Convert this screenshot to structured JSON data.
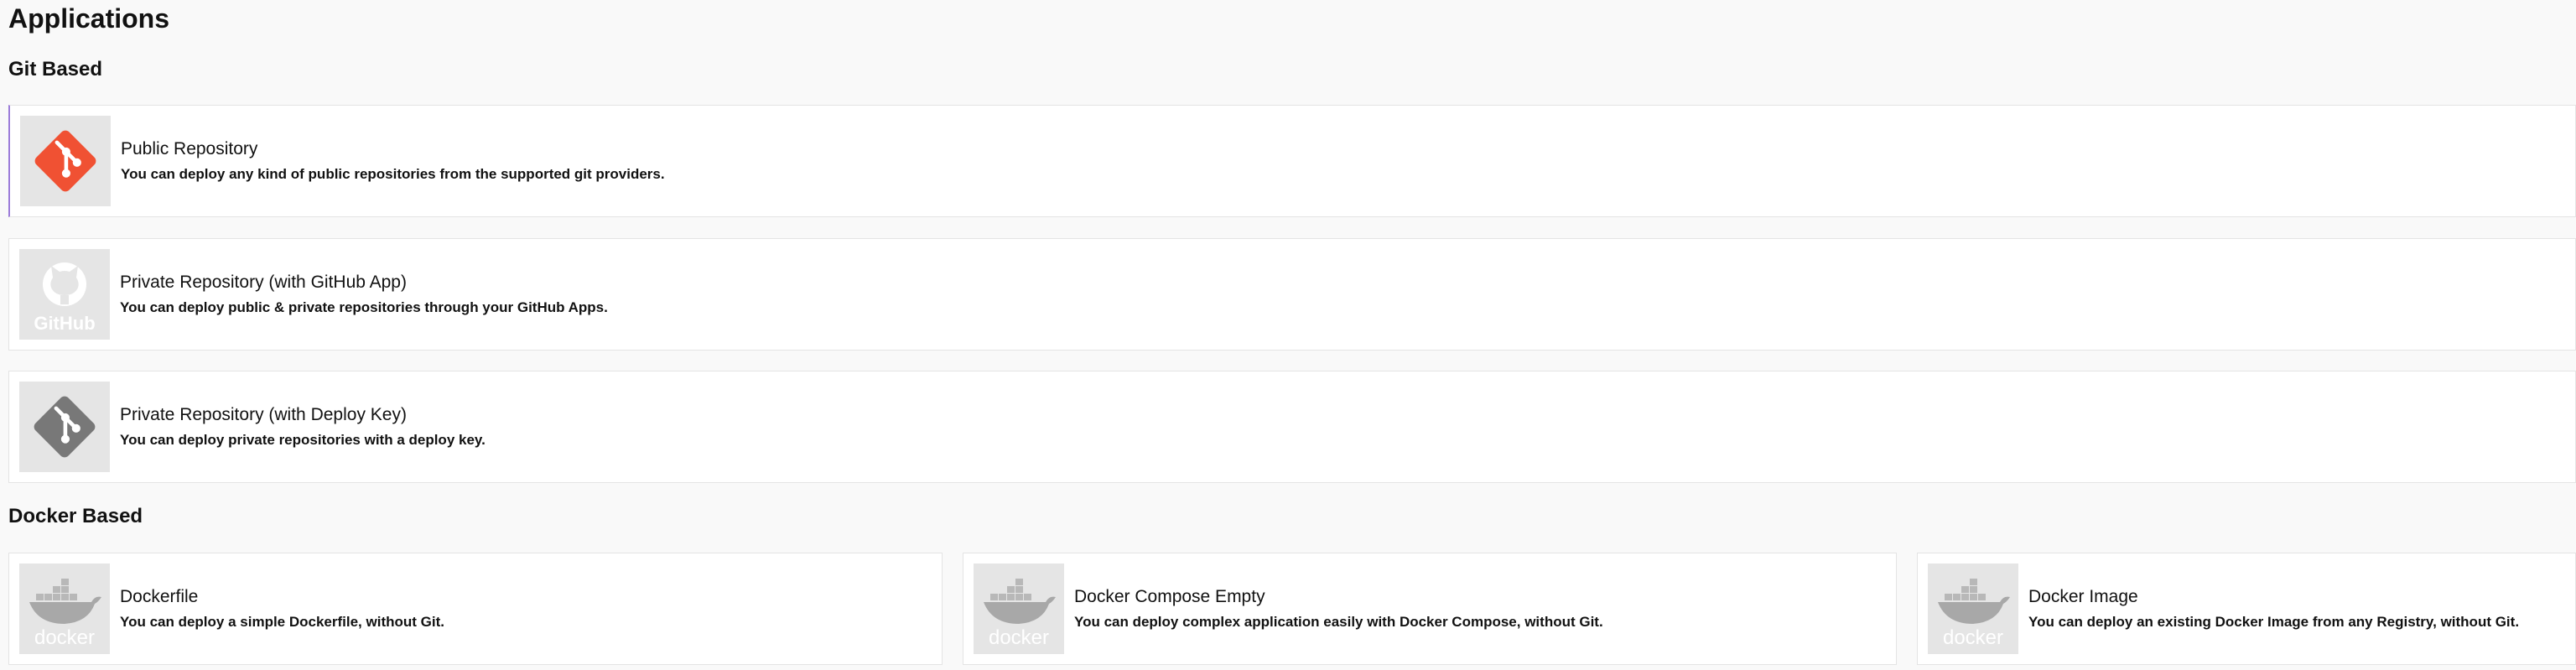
{
  "page": {
    "title": "Applications"
  },
  "git": {
    "heading": "Git Based",
    "items": [
      {
        "title": "Public Repository",
        "description": "You can deploy any kind of public repositories from the supported git providers.",
        "icon": "git-icon"
      },
      {
        "title": "Private Repository (with GitHub App)",
        "description": "You can deploy public & private repositories through your GitHub Apps.",
        "icon": "github-icon",
        "logo_text": "GitHub"
      },
      {
        "title": "Private Repository (with Deploy Key)",
        "description": "You can deploy private repositories with a deploy key.",
        "icon": "git-icon"
      }
    ]
  },
  "docker": {
    "heading": "Docker Based",
    "items": [
      {
        "title": "Dockerfile",
        "description": "You can deploy a simple Dockerfile, without Git.",
        "icon": "docker-icon",
        "logo_text": "docker"
      },
      {
        "title": "Docker Compose Empty",
        "description": "You can deploy complex application easily with Docker Compose, without Git.",
        "icon": "docker-icon",
        "logo_text": "docker"
      },
      {
        "title": "Docker Image",
        "description": "You can deploy an existing Docker Image from any Registry, without Git.",
        "icon": "docker-icon",
        "logo_text": "docker"
      }
    ]
  },
  "colors": {
    "git_active": "#f05133",
    "git_muted": "#787878",
    "accent_border": "#9b7bd9",
    "thumb_bg": "#e5e5e5"
  }
}
